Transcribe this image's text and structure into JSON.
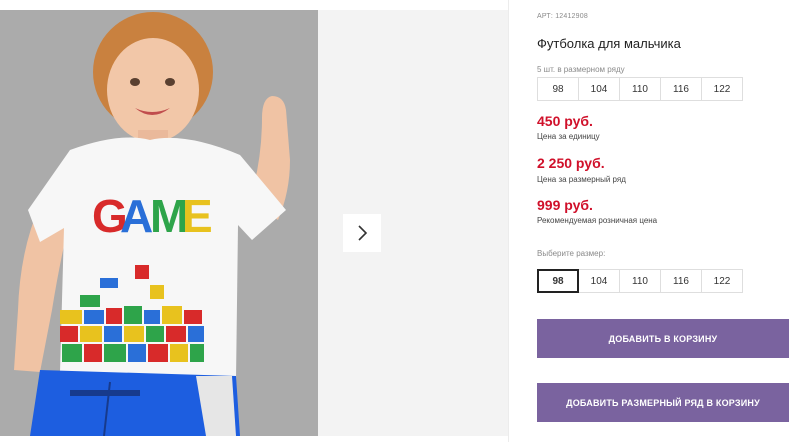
{
  "product": {
    "article": "АРТ: 12412908",
    "title": "Футболка для мальчика",
    "pack_note": "5 шт. в размерном ряду",
    "pack_sizes": [
      "98",
      "104",
      "110",
      "116",
      "122"
    ]
  },
  "prices": [
    {
      "value": "450 руб.",
      "label": "Цена за единицу"
    },
    {
      "value": "2 250 руб.",
      "label": "Цена за размерный ряд"
    },
    {
      "value": "999 руб.",
      "label": "Рекомендуемая розничная цена"
    }
  ],
  "size_select": {
    "label": "Выберите размер:",
    "sizes": [
      "98",
      "104",
      "110",
      "116",
      "122"
    ],
    "selected": "98"
  },
  "buttons": {
    "add_to_cart": "ДОБАВИТЬ В КОРЗИНУ",
    "add_pack_to_cart": "ДОБАВИТЬ РАЗМЕРНЫЙ РЯД В КОРЗИНУ"
  },
  "photo": {
    "shirt_print": "GAME"
  },
  "colors": {
    "price": "#d0102a",
    "button": "#7a639f"
  },
  "icons": {
    "next": "chevron-right-icon"
  }
}
